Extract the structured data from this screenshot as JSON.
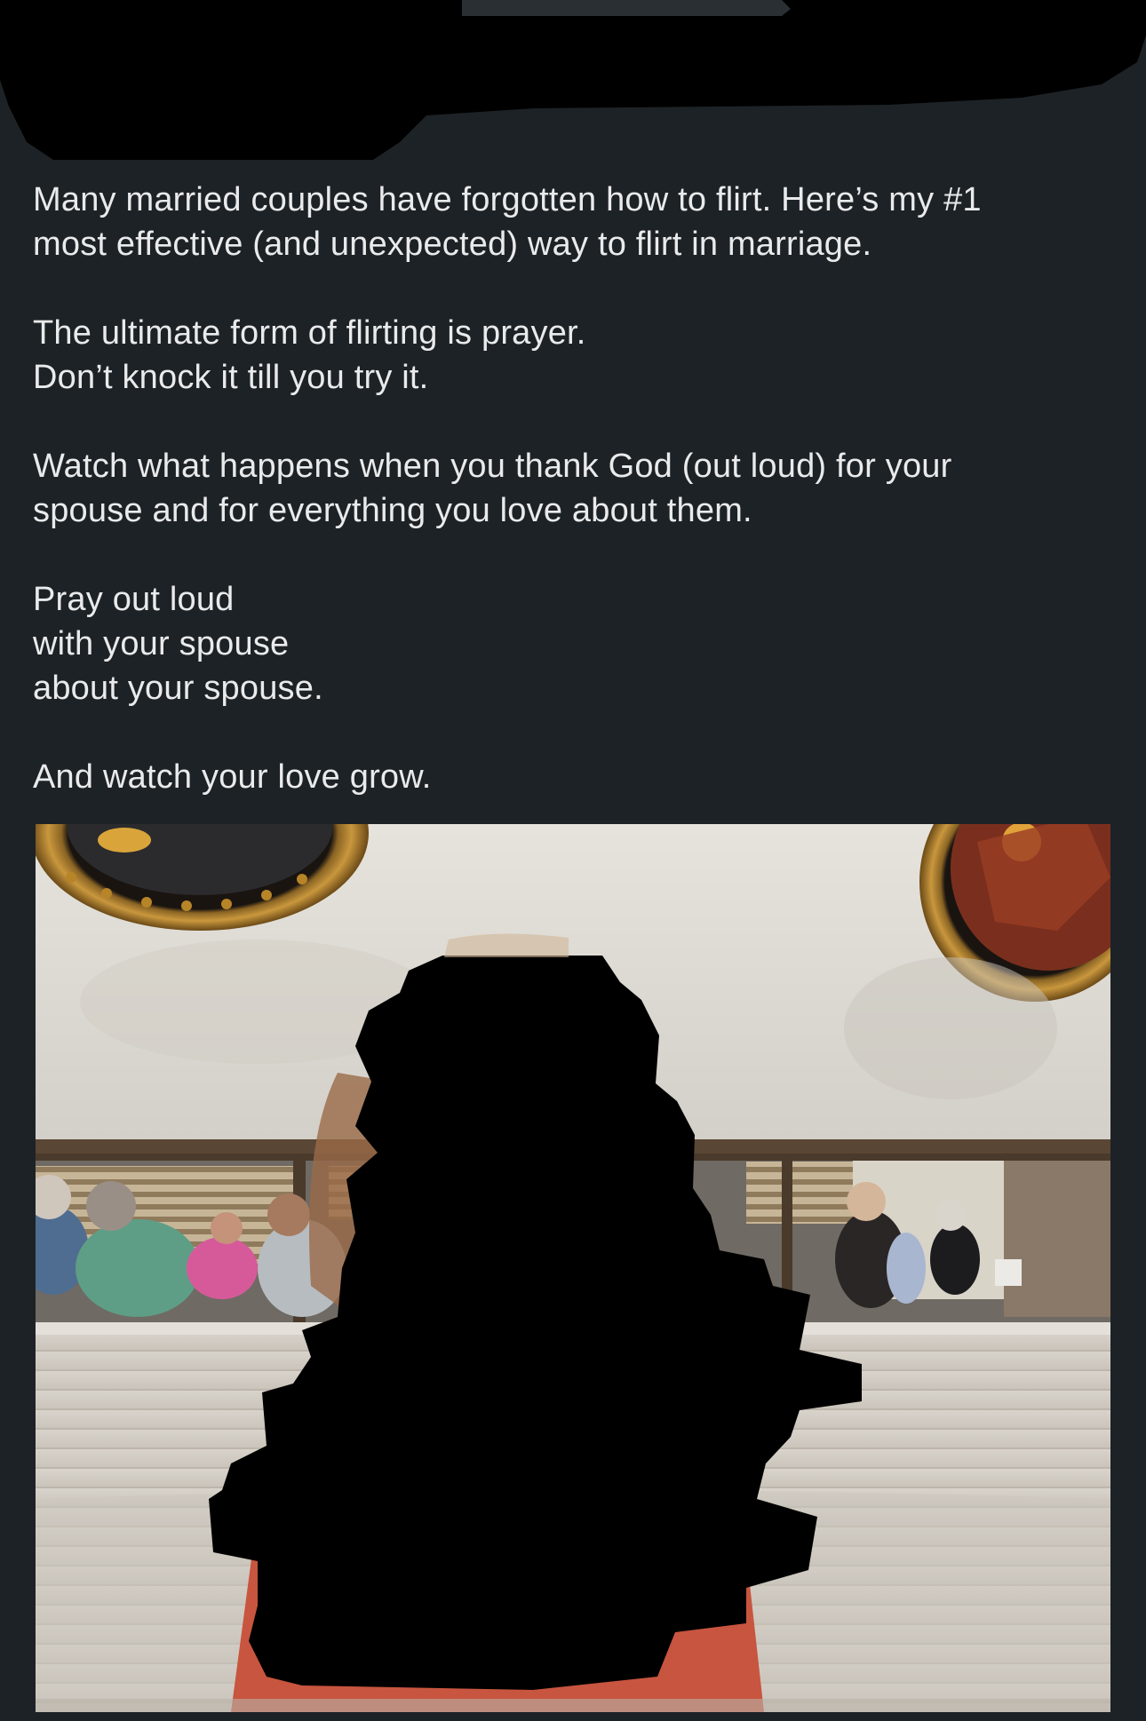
{
  "post": {
    "paragraphs": [
      {
        "lines": [
          "Many married couples have forgotten how to flirt. Here’s my #1",
          "most effective (and unexpected) way to flirt in marriage."
        ]
      },
      {
        "lines": [
          "The ultimate form of flirting is prayer.",
          "Don’t knock it till you try it."
        ]
      },
      {
        "lines": [
          "Watch what happens when you thank God (out loud) for your",
          "spouse and for everything you love about them."
        ]
      },
      {
        "lines": [
          "Pray out loud",
          "with your spouse",
          "about your spouse."
        ]
      },
      {
        "lines": [
          "And watch your love grow."
        ]
      }
    ]
  },
  "image": {
    "subject": "restaurant-booth-photo",
    "redacted_subject": true
  },
  "colors": {
    "background": "#1d2226",
    "text": "#e9eaeb",
    "redaction": "#000000"
  }
}
